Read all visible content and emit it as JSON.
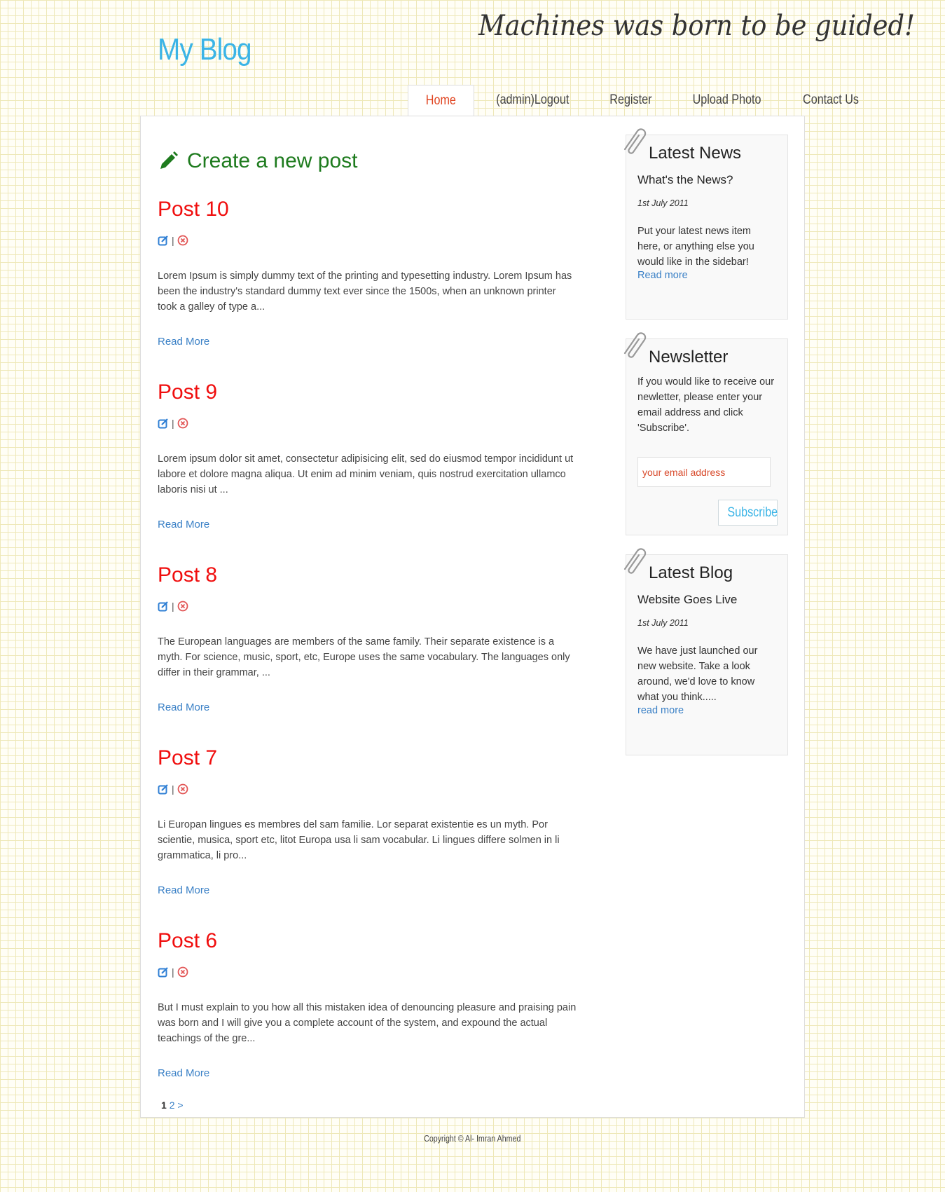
{
  "header": {
    "site_title": "My Blog",
    "tagline": "Machines was born to be guided!"
  },
  "nav": {
    "items": [
      {
        "label": "Home",
        "active": true
      },
      {
        "label": "(admin)Logout"
      },
      {
        "label": "Register"
      },
      {
        "label": "Upload Photo"
      },
      {
        "label": "Contact Us"
      }
    ]
  },
  "main": {
    "create_post_label": "Create a new post",
    "action_separator": "|",
    "posts": [
      {
        "title": "Post 10",
        "excerpt": "Lorem Ipsum is simply dummy text of the printing and typesetting industry. Lorem Ipsum has been the industry's standard dummy text ever since the 1500s, when an unknown printer took a galley of type a...",
        "read_more": "Read More"
      },
      {
        "title": "Post 9",
        "excerpt": "Lorem ipsum dolor sit amet, consectetur adipisicing elit, sed do eiusmod tempor incididunt ut labore et dolore magna aliqua. Ut enim ad minim veniam, quis nostrud exercitation ullamco laboris nisi ut ...",
        "read_more": "Read More"
      },
      {
        "title": "Post 8",
        "excerpt": "The European languages are members of the same family. Their separate existence is a myth. For science, music, sport, etc, Europe uses the same vocabulary. The languages only differ in their grammar, ...",
        "read_more": "Read More"
      },
      {
        "title": "Post 7",
        "excerpt": "Li Europan lingues es membres del sam familie. Lor separat existentie es un myth. Por scientie, musica, sport etc, litot Europa usa li sam vocabular. Li lingues differe solmen in li grammatica, li pro...",
        "read_more": "Read More"
      },
      {
        "title": "Post 6",
        "excerpt": "But I must explain to you how all this mistaken idea of denouncing pleasure and praising pain was born and I will give you a complete account of the system, and expound the actual teachings of the gre...",
        "read_more": "Read More"
      }
    ],
    "pagination": {
      "current": "1",
      "next_page": "2",
      "next_arrow": ">"
    }
  },
  "sidebar": {
    "latest_news": {
      "title": "Latest News",
      "subtitle": "What's the News?",
      "date": "1st July 2011",
      "text": "Put your latest news item here, or anything else you would like in the sidebar!",
      "link": "Read more"
    },
    "newsletter": {
      "title": "Newsletter",
      "text": "If you would like to receive our newletter, please enter your email address and click 'Subscribe'.",
      "email_placeholder": "your email address",
      "subscribe_label": "Subscribe"
    },
    "latest_blog": {
      "title": "Latest Blog",
      "subtitle": "Website Goes Live",
      "date": "1st July 2011",
      "text": "We have just launched our new website. Take a look around, we'd love to know what you think.....",
      "link": "read more"
    }
  },
  "footer": {
    "copyright": "Copyright © Al- Imran Ahmed"
  },
  "colors": {
    "accent_blue": "#3bb4e6",
    "post_title_red": "#f00e0e",
    "create_green": "#1e7b1e",
    "nav_active": "#e0431f",
    "link_blue": "#3a80c6"
  }
}
